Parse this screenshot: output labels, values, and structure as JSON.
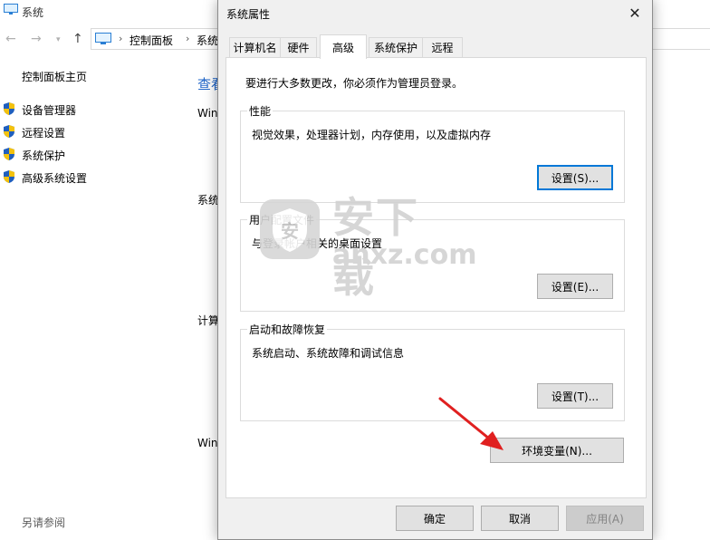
{
  "bg_window": {
    "title": "系统",
    "breadcrumb": [
      "控制面板",
      "系统"
    ],
    "sidebar_home": "控制面板主页",
    "sidebar_links": [
      "设备管理器",
      "远程设置",
      "系统保护",
      "高级系统设置"
    ],
    "see_also": "另请参阅",
    "cut_title": "查看",
    "cut_section_1": "Win",
    "cut_section_2": "系统",
    "cut_section_3": "计算",
    "cut_section_4": "Win"
  },
  "dialog": {
    "title": "系统属性",
    "tabs": [
      "计算机名",
      "硬件",
      "高级",
      "系统保护",
      "远程"
    ],
    "active_tab": "高级",
    "notice": "要进行大多数更改，你必须作为管理员登录。",
    "performance": {
      "label": "性能",
      "desc": "视觉效果，处理器计划，内存使用，以及虚拟内存",
      "button": "设置(S)..."
    },
    "user_profiles": {
      "label": "用户配置文件",
      "desc": "与登录帐户相关的桌面设置",
      "button": "设置(E)..."
    },
    "startup_recovery": {
      "label": "启动和故障恢复",
      "desc": "系统启动、系统故障和调试信息",
      "button": "设置(T)..."
    },
    "env_button": "环境变量(N)...",
    "ok": "确定",
    "cancel": "取消",
    "apply": "应用(A)"
  },
  "watermark": {
    "logo_char": "安",
    "cn": "安下载",
    "en": "anxz.com"
  },
  "colors": {
    "accent_focus": "#0078d7",
    "arrow": "#e02020",
    "link_blue": "#1e64c8"
  },
  "icons": [
    "system-icon",
    "back-arrow-icon",
    "forward-arrow-icon",
    "up-arrow-icon",
    "computer-icon",
    "shield-icon",
    "close-icon"
  ]
}
